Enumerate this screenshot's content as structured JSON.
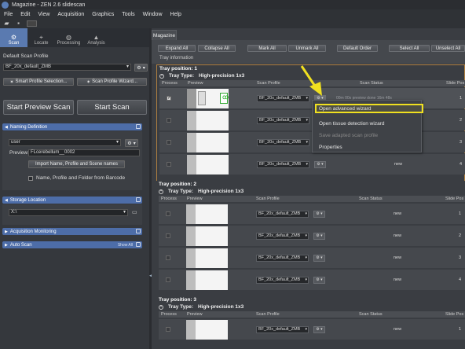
{
  "window": {
    "title": "Magazine - ZEN 2.6 slidescan"
  },
  "menu": [
    "File",
    "Edit",
    "View",
    "Acquisition",
    "Graphics",
    "Tools",
    "Window",
    "Help"
  ],
  "left_tabs": [
    {
      "label": "Scan",
      "icon": "scan-icon"
    },
    {
      "label": "Locate",
      "icon": "locate-icon"
    },
    {
      "label": "Processing",
      "icon": "processing-icon"
    },
    {
      "label": "Analysis",
      "icon": "analysis-icon"
    }
  ],
  "scan_profile": {
    "heading": "Default Scan Profile",
    "value": "BF_20x_default_ZMB",
    "smart_btn": "Smart Profile Selection...",
    "wizard_btn": "Scan Profile Wizard..."
  },
  "actions": {
    "preview": "Start Preview Scan",
    "scan": "Start Scan"
  },
  "naming": {
    "title": "Naming Definition",
    "user_value": "user",
    "preview_label": "Preview:",
    "preview_value": "FLcerebellum__0002",
    "import_btn": "Import Name, Profile and Scene names",
    "barcode_label": "Name, Profile and Folder from Barcode"
  },
  "storage": {
    "title": "Storage Location",
    "path": "X:\\"
  },
  "acq_monitoring": {
    "title": "Acquisition Monitoring"
  },
  "auto_scan": {
    "title": "Auto Scan",
    "show_all": "Show All"
  },
  "magazine": {
    "tab": "Magazine",
    "buttons": [
      "Expand All",
      "Collapse All",
      "Mark All",
      "Unmark All",
      "Default Order",
      "Select All",
      "Unselect All"
    ],
    "tray_info": "Tray information",
    "columns": {
      "process": "Process",
      "preview": "Preview",
      "profile": "Scan Profile",
      "status": "Scan Status",
      "slide": "Slide Pos"
    },
    "trays": [
      {
        "position_label": "Tray position:  1",
        "type_label": "Tray Type:",
        "type_value": "High-precision 1x3",
        "rows": [
          {
            "profile": "BF_20x_default_ZMB",
            "status": "00m 00s    preview done    16m 48s",
            "slide": "1"
          },
          {
            "profile": "BF_20x_default_ZMB",
            "status": "",
            "slide": "2"
          },
          {
            "profile": "BF_20x_default_ZMB",
            "status": "",
            "slide": "3"
          },
          {
            "profile": "BF_20x_default_ZMB",
            "status": "new",
            "slide": "4"
          }
        ]
      },
      {
        "position_label": "Tray position:  2",
        "type_label": "Tray Type:",
        "type_value": "High-precision 1x3",
        "rows": [
          {
            "profile": "BF_20x_default_ZMB",
            "status": "new",
            "slide": "1"
          },
          {
            "profile": "BF_20x_default_ZMB",
            "status": "new",
            "slide": "2"
          },
          {
            "profile": "BF_20x_default_ZMB",
            "status": "new",
            "slide": "3"
          },
          {
            "profile": "BF_20x_default_ZMB",
            "status": "new",
            "slide": "4"
          }
        ]
      },
      {
        "position_label": "Tray position:  3",
        "type_label": "Tray Type:",
        "type_value": "High-precision 1x3",
        "rows": [
          {
            "profile": "BF_20x_default_ZMB",
            "status": "new",
            "slide": "1"
          }
        ]
      }
    ]
  },
  "context_menu": {
    "items": [
      {
        "label": "Open advanced wizard",
        "enabled": true
      },
      {
        "label": "Open tissue detection wizard",
        "enabled": true
      },
      {
        "label": "Save adapted scan profile",
        "enabled": false
      },
      {
        "label": "Properties",
        "enabled": true
      }
    ]
  },
  "colors": {
    "accent": "#4d6da8",
    "highlight": "#f0e020"
  }
}
